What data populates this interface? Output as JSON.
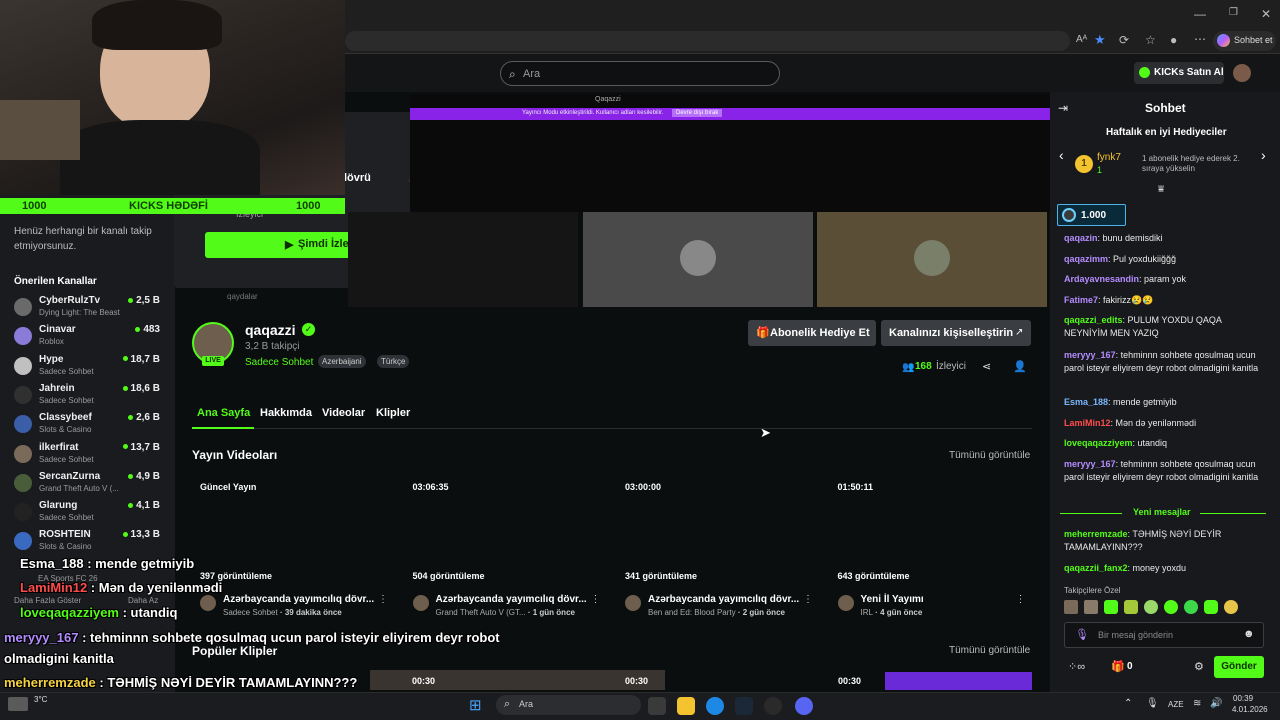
{
  "browser": {
    "window_controls": [
      "—",
      "❐",
      "✕"
    ],
    "profile_label": "Sohbet et"
  },
  "header": {
    "search_placeholder": "Ara",
    "buy_kicks": "KICKs Satın Al"
  },
  "goal": {
    "left_value": "1000",
    "label": "KICKS HƏDƏFİ",
    "right_value": "1000"
  },
  "popup": {
    "title_fragment": "lövrü",
    "viewers_fragment": "İzleyici",
    "watch_button": "Şimdi İzle",
    "channel_fragment": "qaydalar",
    "inner_banner": "Yayıncı Modu etkinleştirildi. Kullanıcı adları kesilebilir.",
    "inner_banner_btn": "Devre dışı bırak",
    "inner_title": "Qaqazzi"
  },
  "sidebar": {
    "following_empty": "Henüz herhangi bir kanalı takip etmiyorsunuz.",
    "recommended_title": "Önerilen Kanallar",
    "channels": [
      {
        "name": "CyberRulzTv",
        "game": "Dying Light: The Beast",
        "viewers": "2,5 B",
        "color": "#6a6a6a"
      },
      {
        "name": "Cinavar",
        "game": "Roblox",
        "viewers": "483",
        "color": "#8a7bd8"
      },
      {
        "name": "Hype",
        "game": "Sadece Sohbet",
        "viewers": "18,7 B",
        "color": "#c0c0c0"
      },
      {
        "name": "Jahrein",
        "game": "Sadece Sohbet",
        "viewers": "18,6 B",
        "color": "#303030"
      },
      {
        "name": "Classybeef",
        "game": "Slots & Casino",
        "viewers": "2,6 B",
        "color": "#3a5ea8"
      },
      {
        "name": "ilkerfirat",
        "game": "Sadece Sohbet",
        "viewers": "13,7 B",
        "color": "#7a6a5a"
      },
      {
        "name": "SercanZurna",
        "game": "Grand Theft Auto V (...",
        "viewers": "4,9 B",
        "color": "#4a5d3a"
      },
      {
        "name": "Glarung",
        "game": "Sadece Sohbet",
        "viewers": "4,1 B",
        "color": "#222"
      },
      {
        "name": "ROSHTEIN",
        "game": "Slots & Casino",
        "viewers": "13,3 B",
        "color": "#3a6ac0"
      }
    ],
    "partial_game": "EA Sports FC 26",
    "show_more": "Daha Fazla Göster",
    "show_less": "Daha Az"
  },
  "channel": {
    "name": "qaqazzi",
    "followers": "3,2 B takipçi",
    "category": "Sadece Sohbet",
    "tags": [
      "Azerbaijani",
      "Türkçe"
    ],
    "live_badge": "LIVE",
    "gift_sub_button": "Abonelik Hediye Et",
    "customize_button": "Kanalınızı kişiselleştirin",
    "viewer_count": "168",
    "viewer_label": "İzleyici",
    "tabs": [
      "Ana Sayfa",
      "Hakkımda",
      "Videolar",
      "Klipler"
    ]
  },
  "videos": {
    "section_title": "Yayın Videoları",
    "view_all": "Tümünü görüntüle",
    "items": [
      {
        "badge": "Güncel Yayın",
        "views": "397 görüntüleme",
        "title": "Azərbaycanda yayımcılıq dövr...",
        "meta_game": "Sadece Sohbet",
        "meta_time": " · 39 dakika önce"
      },
      {
        "badge": "03:06:35",
        "views": "504 görüntüleme",
        "title": "Azərbaycanda yayımcılıq dövr...",
        "meta_game": "Grand Theft Auto V (GT...",
        "meta_time": " · 1 gün önce"
      },
      {
        "badge": "03:00:00",
        "views": "341 görüntüleme",
        "title": "Azərbaycanda yayımcılıq dövr...",
        "meta_game": "Ben and Ed: Blood Party",
        "meta_time": " · 2 gün önce"
      },
      {
        "badge": "01:50:11",
        "views": "643 görüntüleme",
        "title": "Yeni İl Yayımı",
        "meta_game": "IRL",
        "meta_time": " · 4 gün önce"
      }
    ]
  },
  "clips": {
    "section_title": "Popüler Klipler",
    "view_all": "Tümünü görüntüle",
    "durations": [
      "00:30",
      "00:30",
      "00:30"
    ]
  },
  "chat": {
    "title": "Sohbet",
    "top_gifters_title": "Haftalık en iyi Hediyeciler",
    "top_gifter_name": "fynk7",
    "top_gifter_count": "1",
    "top_gifter_hint": "1 abonelik hediye ederek 2. sıraya yükselin",
    "pinned_amount": "1.000",
    "messages": [
      {
        "user": "qaqazin",
        "text": ": bunu demisdiki",
        "cls": "u-purple"
      },
      {
        "user": "qaqazimm",
        "text": ": Pul yoxdukiiğğğ",
        "cls": "u-purple"
      },
      {
        "user": "Ardayavnesandin",
        "text": ": param yok",
        "cls": "u-purple"
      },
      {
        "user": "Fatime7",
        "text": ": fakirizz😢😢",
        "cls": "u-purple"
      },
      {
        "user": "qaqazzi_edits",
        "text": ": PULUM YOXDU QAQA NEYNİYİM MEN YAZIQ",
        "cls": "u-green"
      },
      {
        "user": "meryyy_167",
        "text": ": tehminnn sohbete qosulmaq ucun parol isteyir eliyirem deyr robot olmadigini kanitla",
        "cls": "u-purple"
      },
      {
        "user": "Esma_188",
        "text": ": mende getmiyib",
        "cls": "u-blue"
      },
      {
        "user": "LamiMin12",
        "text": ": Mən də yenilənmədi",
        "cls": "u-red"
      },
      {
        "user": "loveqaqazziyem",
        "text": ": utandiq",
        "cls": "u-green"
      },
      {
        "user": "meryyy_167",
        "text": ": tehminnn sohbete qosulmaq ucun parol isteyir eliyirem deyr robot olmadigini kanitla",
        "cls": "u-purple"
      }
    ],
    "new_messages_label": "Yeni mesajlar",
    "new_messages": [
      {
        "user": "meherremzade",
        "text": ": TƏHMİŞ NƏYİ DEYİR TAMAMLAYINN???",
        "cls": "u-green"
      },
      {
        "user": "qaqazzii_fanx2",
        "text": ": money yoxdu",
        "cls": "u-green"
      }
    ],
    "emote_section": "Takipçilere Özel",
    "input_placeholder": "Bir mesaj gönderin",
    "kicks_count": "0",
    "send_button": "Gönder"
  },
  "overlay_chat": [
    {
      "user": "Esma_188",
      "text": " : mende getmiyib",
      "color": "#ffffff"
    },
    {
      "user": "LamiMin12",
      "text": " : Mən də yenilənmədi",
      "color": "#ff4d4d"
    },
    {
      "user": "loveqaqazziyem",
      "text": " : utandiq",
      "color": "#53fc18"
    },
    {
      "user": "meryyy_167",
      "text": " : tehminnn sohbete qosulmaq ucun parol isteyir eliyirem deyr robot",
      "color": "#b48cff"
    },
    {
      "user": "",
      "text": "olmadigini kanitla",
      "color": "#ffffff"
    },
    {
      "user": "meherremzade",
      "text": " : TƏHMİŞ NƏYİ DEYİR TAMAMLAYINN???",
      "color": "#f6d342"
    },
    {
      "user": "qaqazzii_fanx2",
      "text": " : money yoxdu",
      "color": "#ffffff"
    }
  ],
  "taskbar": {
    "search_placeholder": "Ara",
    "weather": "3°C",
    "language": "AZE",
    "time": "00:39",
    "date": "4.01.2026"
  }
}
